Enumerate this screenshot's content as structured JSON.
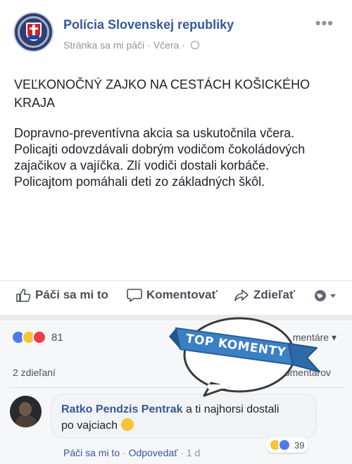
{
  "header": {
    "page_name": "Polícia Slovenskej republiky",
    "meta_liked": "Stránka sa mi páči",
    "meta_sep": "·",
    "meta_time": "Včera",
    "meta_sep2": "·",
    "more_label": "•••"
  },
  "post": {
    "title": "VEĽKONOČNÝ ZAJKO NA CESTÁCH KOŠICKÉHO KRAJA",
    "body": [
      "Dopravno-preventívna akcia sa uskutočnila včera.",
      "Policajti odovzdávali dobrým vodičom čokoládových",
      "zajačikov a vajíčka. Zlí vodiči dostali korbáče.",
      "Policajtom pomáhali deti zo základných škôl."
    ]
  },
  "actions": {
    "like": "Páči sa mi to",
    "comment": "Komentovať",
    "share": "Zdieľať"
  },
  "reactions": {
    "count": "81",
    "filter_label": "mentáre ▾",
    "shares": "2 zdieľaní",
    "view_comments": "komentárov"
  },
  "badge": {
    "text": "TOP KOMENTY"
  },
  "comment": {
    "author": "Ratko Pendzis Pentrak",
    "text_line1": "a ti najhorsi dostali",
    "text_line2": "po vajciach",
    "like": "Páči sa mi to",
    "sep": "·",
    "reply": "Odpovedať",
    "sep2": "·",
    "time": "1 d",
    "reaction_count": "39"
  },
  "colors": {
    "link": "#365899",
    "muted": "#90949c",
    "badge_blue": "#3b7fc4"
  }
}
